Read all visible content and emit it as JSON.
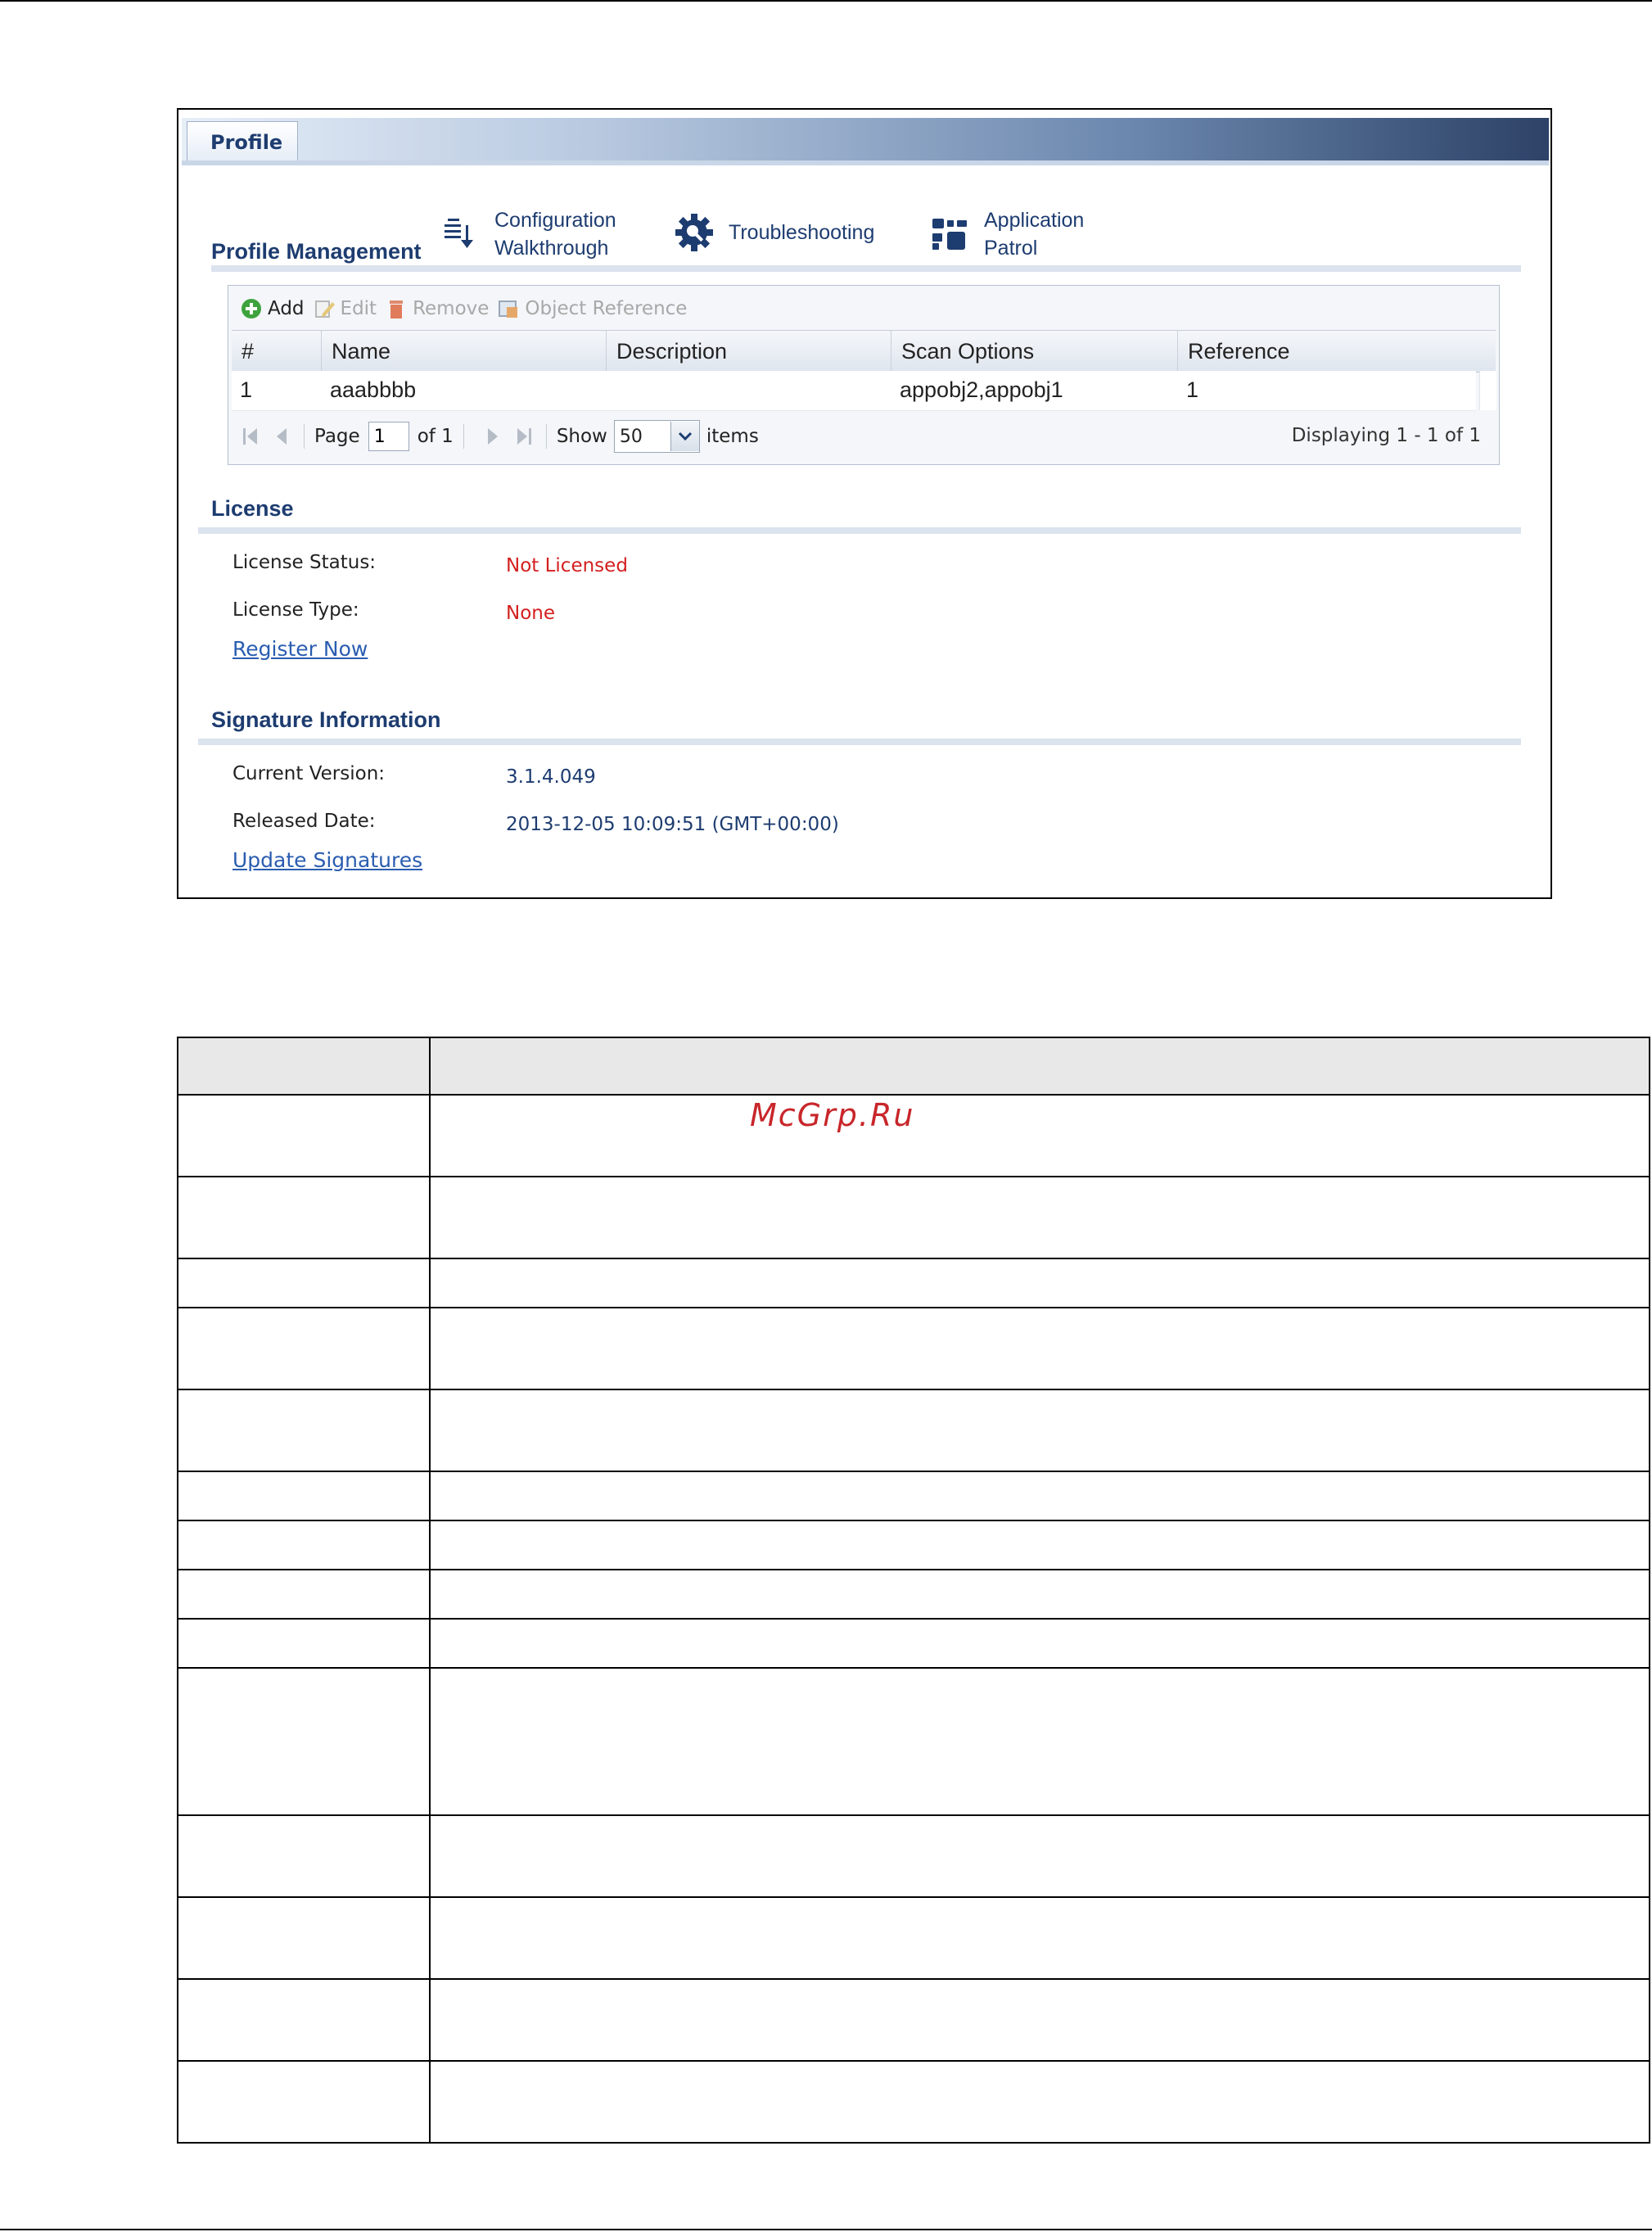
{
  "tab": {
    "label": "Profile"
  },
  "profile_management": {
    "title": "Profile Management",
    "links": [
      {
        "line1": "Configuration",
        "line2": "Walkthrough",
        "icon": "walkthrough-icon"
      },
      {
        "line1": "Troubleshooting",
        "line2": "",
        "icon": "troubleshooting-icon"
      },
      {
        "line1": "Application",
        "line2": "Patrol",
        "icon": "application-patrol-icon"
      }
    ],
    "toolbar": {
      "add": "Add",
      "edit": "Edit",
      "remove": "Remove",
      "object_reference": "Object Reference"
    },
    "columns": [
      "#",
      "Name",
      "Description",
      "Scan Options",
      "Reference"
    ],
    "rows": [
      {
        "num": "1",
        "name": "aaabbbb",
        "description": "",
        "scan_options": "appobj2,appobj1",
        "reference": "1"
      }
    ],
    "pager": {
      "page_label": "Page",
      "page_value": "1",
      "of_label": "of 1",
      "show_label": "Show",
      "show_value": "50",
      "items_label": "items",
      "displaying": "Displaying 1 - 1 of 1"
    }
  },
  "license": {
    "title": "License",
    "status_label": "License Status:",
    "status_value": "Not Licensed",
    "type_label": "License Type:",
    "type_value": "None",
    "register_link": "Register Now"
  },
  "signature": {
    "title": "Signature Information",
    "version_label": "Current Version:",
    "version_value": "3.1.4.049",
    "date_label": "Released Date:",
    "date_value": "2013-12-05 10:09:51 (GMT+00:00)",
    "update_link": "Update Signatures"
  },
  "watermark": "McGrp.Ru",
  "colors": {
    "accent_navy": "#1d3c70",
    "error_red": "#d31f1f",
    "link_blue": "#2a5db0"
  }
}
